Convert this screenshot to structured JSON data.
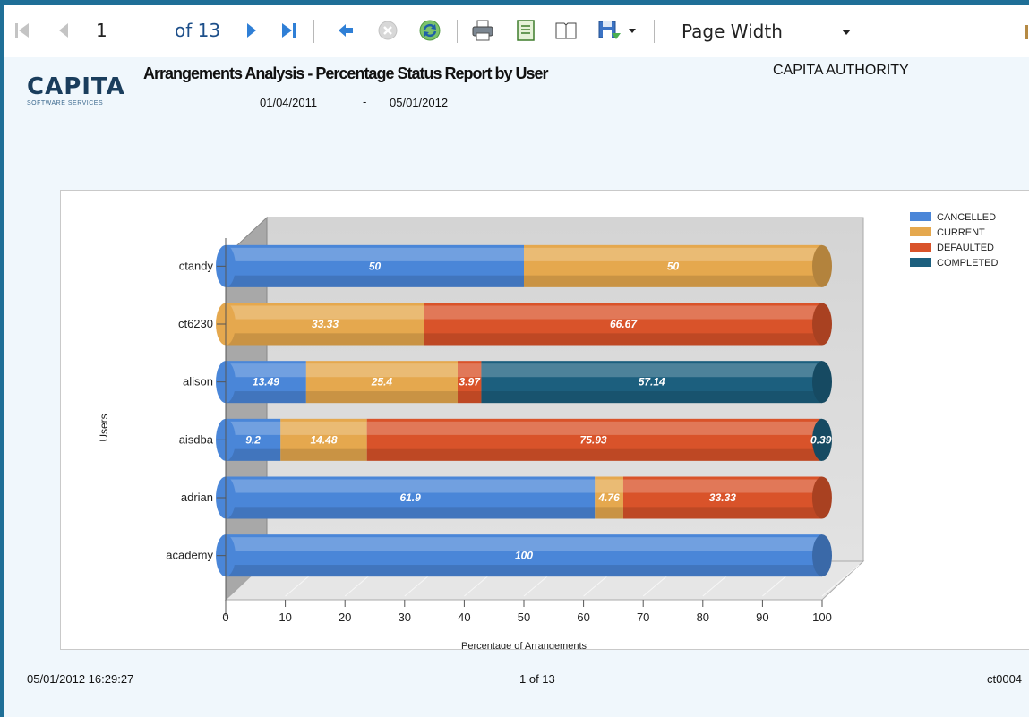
{
  "toolbar": {
    "page_number": "1",
    "page_total_label": "of 13",
    "zoom_value": "Page Width"
  },
  "report": {
    "logo_main": "CAPITA",
    "logo_sub": "SOFTWARE SERVICES",
    "title": "Arrangements Analysis - Percentage Status Report by User",
    "date_from": "01/04/2011",
    "date_separator": "-",
    "date_to": "05/01/2012",
    "authority": "CAPITA AUTHORITY"
  },
  "footer": {
    "timestamp": "05/01/2012 16:29:27",
    "page_indicator": "1 of 13",
    "user_code": "ct0004"
  },
  "chart_data": {
    "type": "bar",
    "orientation": "horizontal",
    "stacked": true,
    "categories": [
      "ctandy",
      "ct6230",
      "alison",
      "aisdba",
      "adrian",
      "academy"
    ],
    "series": [
      {
        "name": "CANCELLED",
        "color": "#4a86d8",
        "values": [
          50,
          0,
          13.49,
          9.2,
          61.9,
          100
        ]
      },
      {
        "name": "CURRENT",
        "color": "#e5a84e",
        "values": [
          50,
          33.33,
          25.4,
          14.48,
          4.76,
          0
        ]
      },
      {
        "name": "DEFAULTED",
        "color": "#d9532a",
        "values": [
          0,
          66.67,
          3.97,
          75.93,
          33.33,
          0
        ]
      },
      {
        "name": "COMPLETED",
        "color": "#1c5f7e",
        "values": [
          0,
          0,
          57.14,
          0.39,
          0,
          0
        ]
      }
    ],
    "xlabel": "Percentage of Arrangements",
    "ylabel": "Users",
    "xlim": [
      0,
      100
    ],
    "xticks": [
      0,
      10,
      20,
      30,
      40,
      50,
      60,
      70,
      80,
      90,
      100
    ],
    "legend_position": "top-right",
    "grid": false
  }
}
